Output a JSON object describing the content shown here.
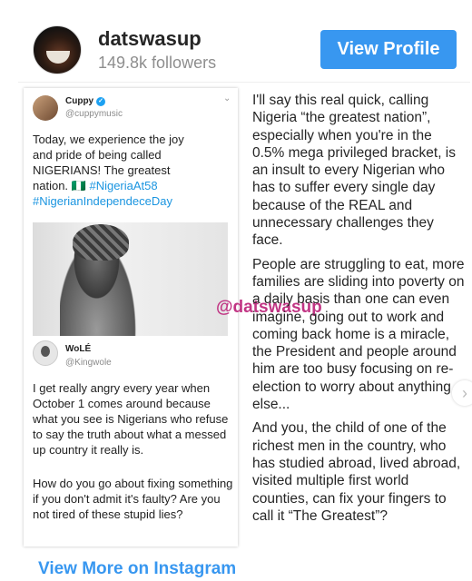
{
  "header": {
    "username": "datswasup",
    "followers": "149.8k followers",
    "view_profile_label": "View Profile"
  },
  "tweet1": {
    "name": "Cuppy",
    "handle": "@cuppymusic",
    "text": "Today, we experience the joy and pride of being called NIGERIANS! The greatest nation. 🇳🇬",
    "hashtag1": "#NigeriaAt58",
    "hashtag2": "#NigerianIndependeceDay"
  },
  "watermark": "@datswasup",
  "tweet2": {
    "name": "WoLÉ",
    "handle": "@Kingwole",
    "paragraph1": "I get really angry every year when October 1 comes around because what you see is Nigerians who refuse to say the truth about what a messed up country it really is.",
    "paragraph2": "How do you go about fixing something if you don't admit it's faulty? Are you not tired of these stupid lies?"
  },
  "caption": {
    "paragraph1": "I'll say this real quick, calling Nigeria “the greatest nation”, especially when you're in the 0.5% mega privileged bracket, is an insult to every Nigerian who has to suffer every single day because of the REAL and unnecessary challenges they face.",
    "paragraph2": "People are struggling to eat, more families are sliding into poverty on a daily basis than one can even imagine, going out to work and coming back home is a miracle, the President and people around him are too busy focusing on re-election to worry about anything else...",
    "paragraph3": "And you, the child of one of the richest men in the country, who has studied abroad, lived abroad, visited multiple first world counties, can fix your fingers to call it “The Greatest”?"
  },
  "footer": {
    "view_more_label": "View More on Instagram"
  },
  "icons": {
    "verified": "verified-badge-icon",
    "chevron": "chevron-down-icon",
    "next": "chevron-right-icon"
  },
  "colors": {
    "accent": "#3897f0",
    "hashtag": "#1b95e0",
    "watermark": "#c13584"
  }
}
